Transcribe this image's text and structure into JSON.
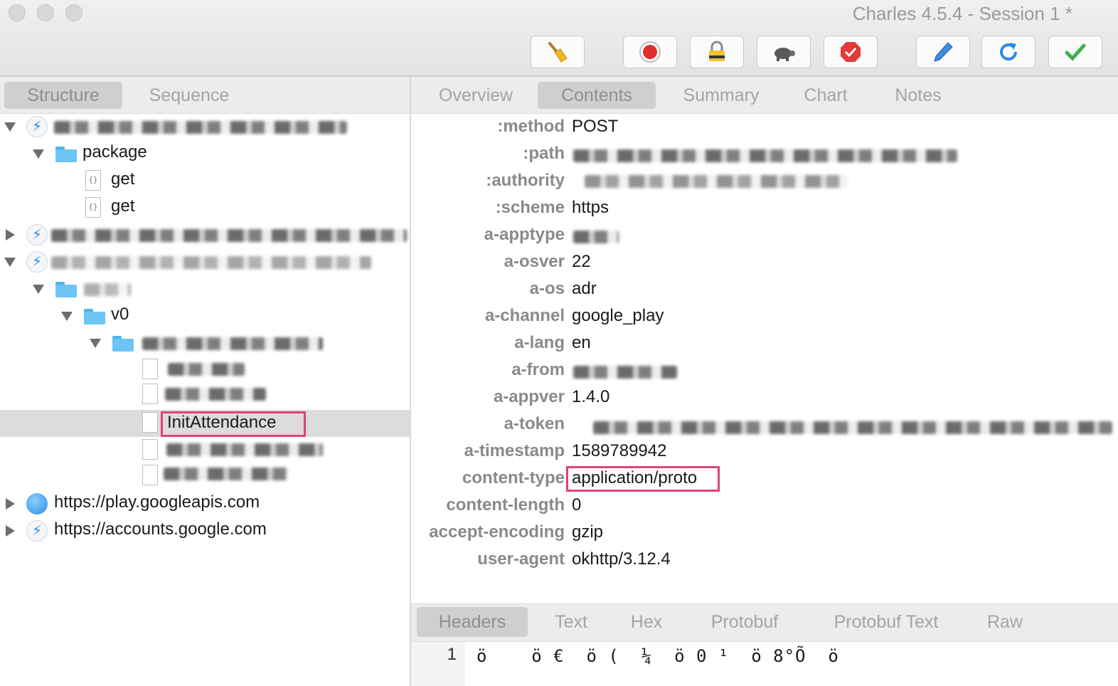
{
  "window": {
    "title": "Charles 4.5.4 - Session 1 *"
  },
  "toolbar": {
    "buttons": [
      {
        "name": "broom-icon"
      },
      {
        "name": "record-icon"
      },
      {
        "name": "ssl-lock-icon"
      },
      {
        "name": "turtle-icon"
      },
      {
        "name": "stop-icon"
      },
      {
        "name": "compose-pen-icon"
      },
      {
        "name": "repeat-icon"
      },
      {
        "name": "validate-check-icon"
      }
    ]
  },
  "left_tabs": [
    "Structure",
    "Sequence"
  ],
  "left_active_tab": "Structure",
  "tree": {
    "package_folder": "package",
    "get_1": "get",
    "get_2": "get",
    "v0_folder": "v0",
    "selected_item": "InitAttendance",
    "host_play": "https://play.googleapis.com",
    "host_accounts": "https://accounts.google.com"
  },
  "right_tabs": [
    "Overview",
    "Contents",
    "Summary",
    "Chart",
    "Notes"
  ],
  "right_active_tab": "Contents",
  "headers": [
    {
      "key": ":method",
      "value": "POST"
    },
    {
      "key": ":path",
      "value": ""
    },
    {
      "key": ":authority",
      "value": ""
    },
    {
      "key": ":scheme",
      "value": "https"
    },
    {
      "key": "a-apptype",
      "value": ""
    },
    {
      "key": "a-osver",
      "value": "22"
    },
    {
      "key": "a-os",
      "value": "adr"
    },
    {
      "key": "a-channel",
      "value": "google_play"
    },
    {
      "key": "a-lang",
      "value": "en"
    },
    {
      "key": "a-from",
      "value": ""
    },
    {
      "key": "a-appver",
      "value": "1.4.0"
    },
    {
      "key": "a-token",
      "value": ""
    },
    {
      "key": "a-timestamp",
      "value": "1589789942"
    },
    {
      "key": "content-type",
      "value": "application/proto"
    },
    {
      "key": "content-length",
      "value": "0"
    },
    {
      "key": "accept-encoding",
      "value": "gzip"
    },
    {
      "key": "user-agent",
      "value": "okhttp/3.12.4"
    }
  ],
  "bottom_tabs": [
    "Headers",
    "Text",
    "Hex",
    "Protobuf",
    "Protobuf Text",
    "Raw"
  ],
  "bottom_active_tab": "Headers",
  "body": {
    "line_number": "1",
    "text": "ö    ö €  ö (  ¼  ö 0 ¹  ö 8°Õ  ö"
  },
  "colors": {
    "highlight": "#e0417a",
    "selected_row": "#dcdcdc",
    "header_key": "#8a8a8a"
  }
}
